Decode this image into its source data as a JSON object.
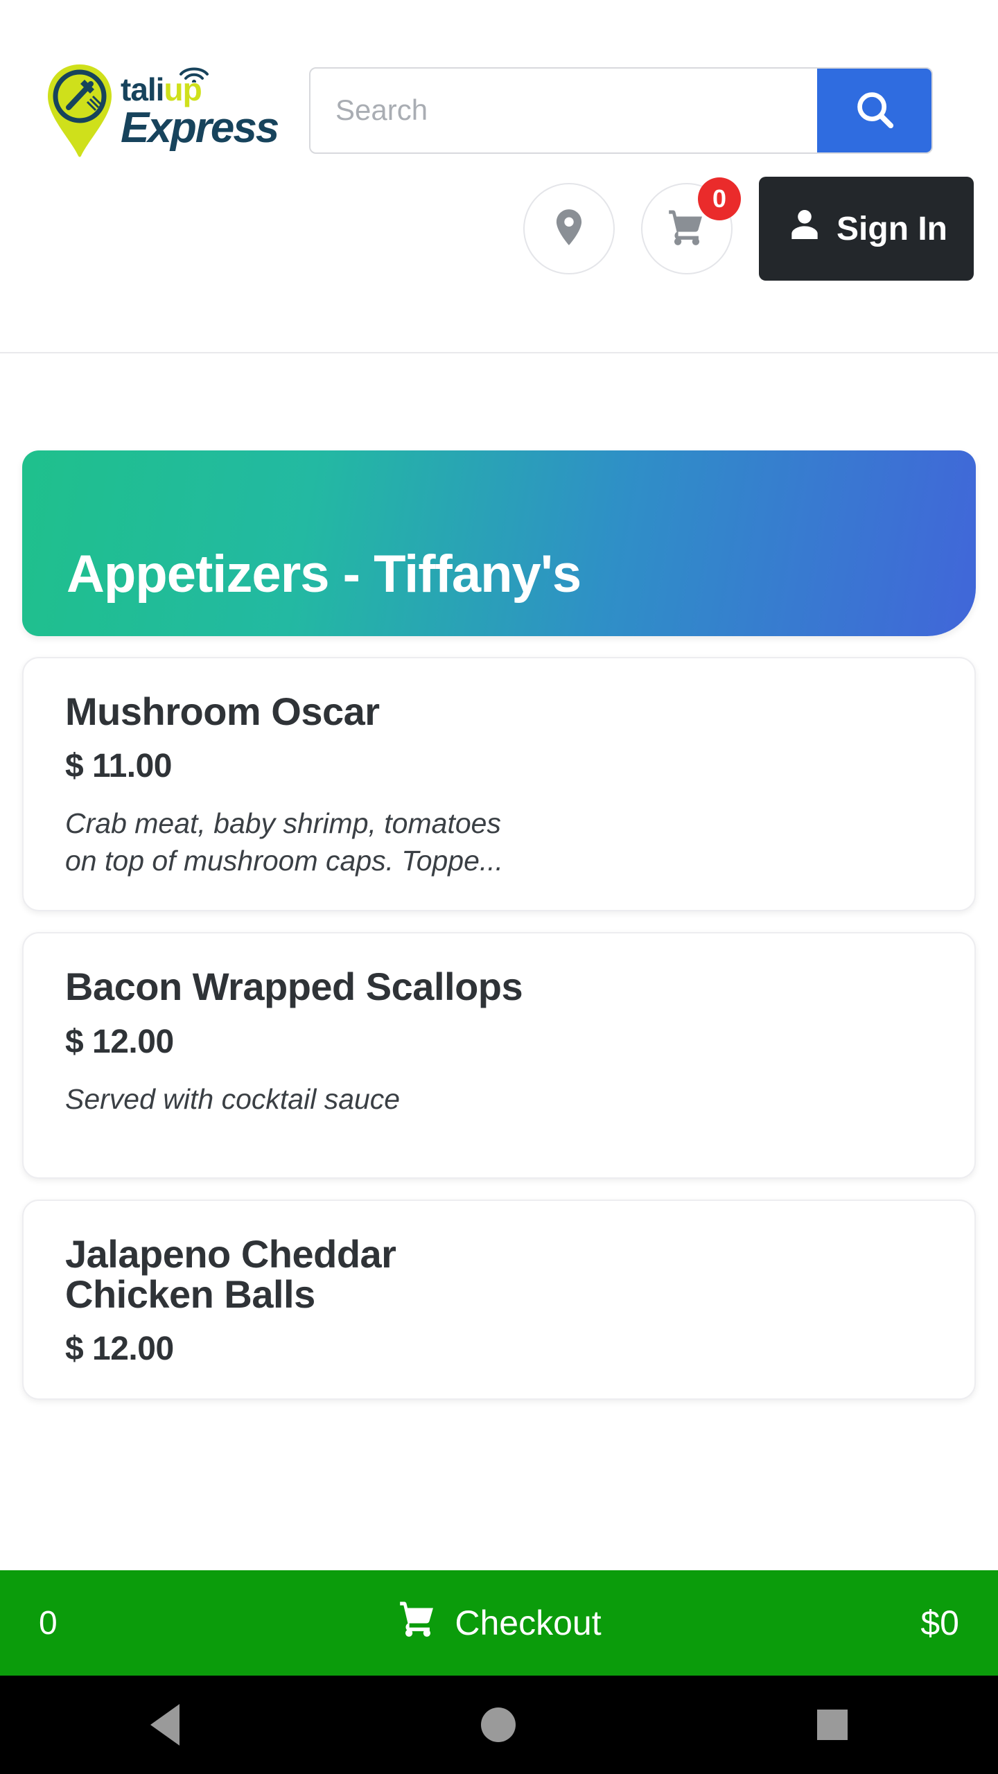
{
  "brand": {
    "name_line1_primary": "tali",
    "name_line1_accent": "up",
    "name_line2": "Express",
    "colors": {
      "navy": "#17435c",
      "lime": "#cfe01b"
    }
  },
  "search": {
    "placeholder": "Search",
    "value": "",
    "button_icon": "search-icon",
    "button_color": "#2f6ce0"
  },
  "header_actions": {
    "location_icon": "location-pin-icon",
    "cart_icon": "shopping-cart-icon",
    "cart_badge_count": "0",
    "cart_badge_color": "#ea2b2b",
    "signin_label": "Sign In",
    "signin_icon": "person-icon",
    "signin_bg": "#23272b"
  },
  "category": {
    "title": "Appetizers - Tiffany's",
    "gradient_from": "#1fc08c",
    "gradient_to": "#4166d9"
  },
  "menu_items": [
    {
      "name": "Mushroom Oscar",
      "price": "$ 11.00",
      "description_line1": "Crab meat, baby shrimp, tomatoes",
      "description_line2": "on top of mushroom caps. Toppe..."
    },
    {
      "name": "Bacon Wrapped Scallops",
      "price": "$ 12.00",
      "description_line1": "Served with cocktail sauce",
      "description_line2": ""
    },
    {
      "name_line1": "Jalapeno Cheddar",
      "name_line2": "Chicken Balls",
      "price": "$ 12.00"
    }
  ],
  "checkout_bar": {
    "item_count": "0",
    "label": "Checkout",
    "icon": "shopping-cart-icon",
    "total": "$0",
    "bg_color": "#0b9c0b"
  },
  "android_nav": {
    "back_icon": "triangle-back-icon",
    "home_icon": "circle-home-icon",
    "recents_icon": "square-recents-icon"
  }
}
